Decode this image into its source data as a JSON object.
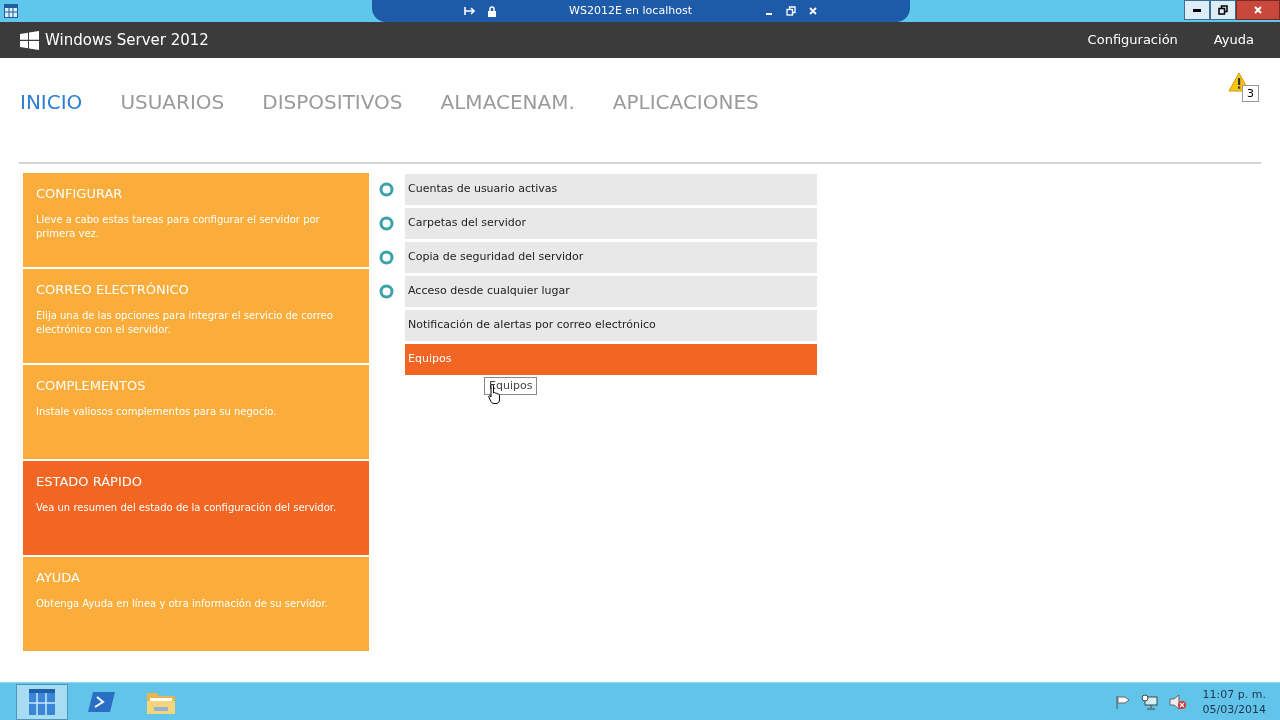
{
  "connection_bar": {
    "title": "WS2012E en localhost"
  },
  "header": {
    "title": "Windows Server 2012",
    "links": [
      "Configuración",
      "Ayuda"
    ]
  },
  "tabs": [
    {
      "label": "INICIO",
      "selected": true
    },
    {
      "label": "USUARIOS",
      "selected": false
    },
    {
      "label": "DISPOSITIVOS",
      "selected": false
    },
    {
      "label": "ALMACENAM.",
      "selected": false
    },
    {
      "label": "APLICACIONES",
      "selected": false
    }
  ],
  "alerts": {
    "count": "3"
  },
  "categories": [
    {
      "title": "CONFIGURAR",
      "description": "Lleve a cabo estas tareas para configurar el servidor por primera vez.",
      "selected": false
    },
    {
      "title": "CORREO ELECTRÓNICO",
      "description": "Elija una de las opciones para integrar el servicio de correo electrónico con el servidor.",
      "selected": false
    },
    {
      "title": "COMPLEMENTOS",
      "description": "Instale valiosos complementos para su negocio.",
      "selected": false
    },
    {
      "title": "ESTADO RÁPIDO",
      "description": "Vea un resumen del estado de la configuración del servidor.",
      "selected": true
    },
    {
      "title": "AYUDA",
      "description": "Obtenga Ayuda en línea y otra información de su servidor.",
      "selected": false
    }
  ],
  "tasks": [
    {
      "label": "Cuentas de usuario activas",
      "kind": "status",
      "selected": false
    },
    {
      "label": "Carpetas del servidor",
      "kind": "status",
      "selected": false
    },
    {
      "label": "Copia de seguridad del servidor",
      "kind": "status",
      "selected": false
    },
    {
      "label": "Acceso desde cualquier lugar",
      "kind": "status",
      "selected": false
    },
    {
      "label": "Notificación de alertas por correo electrónico",
      "kind": "plain",
      "selected": false
    },
    {
      "label": "Equipos",
      "kind": "plain",
      "selected": true
    }
  ],
  "tooltip": "Equipos",
  "taskbar": {
    "time": "11:07 p. m.",
    "date": "05/03/2014"
  }
}
